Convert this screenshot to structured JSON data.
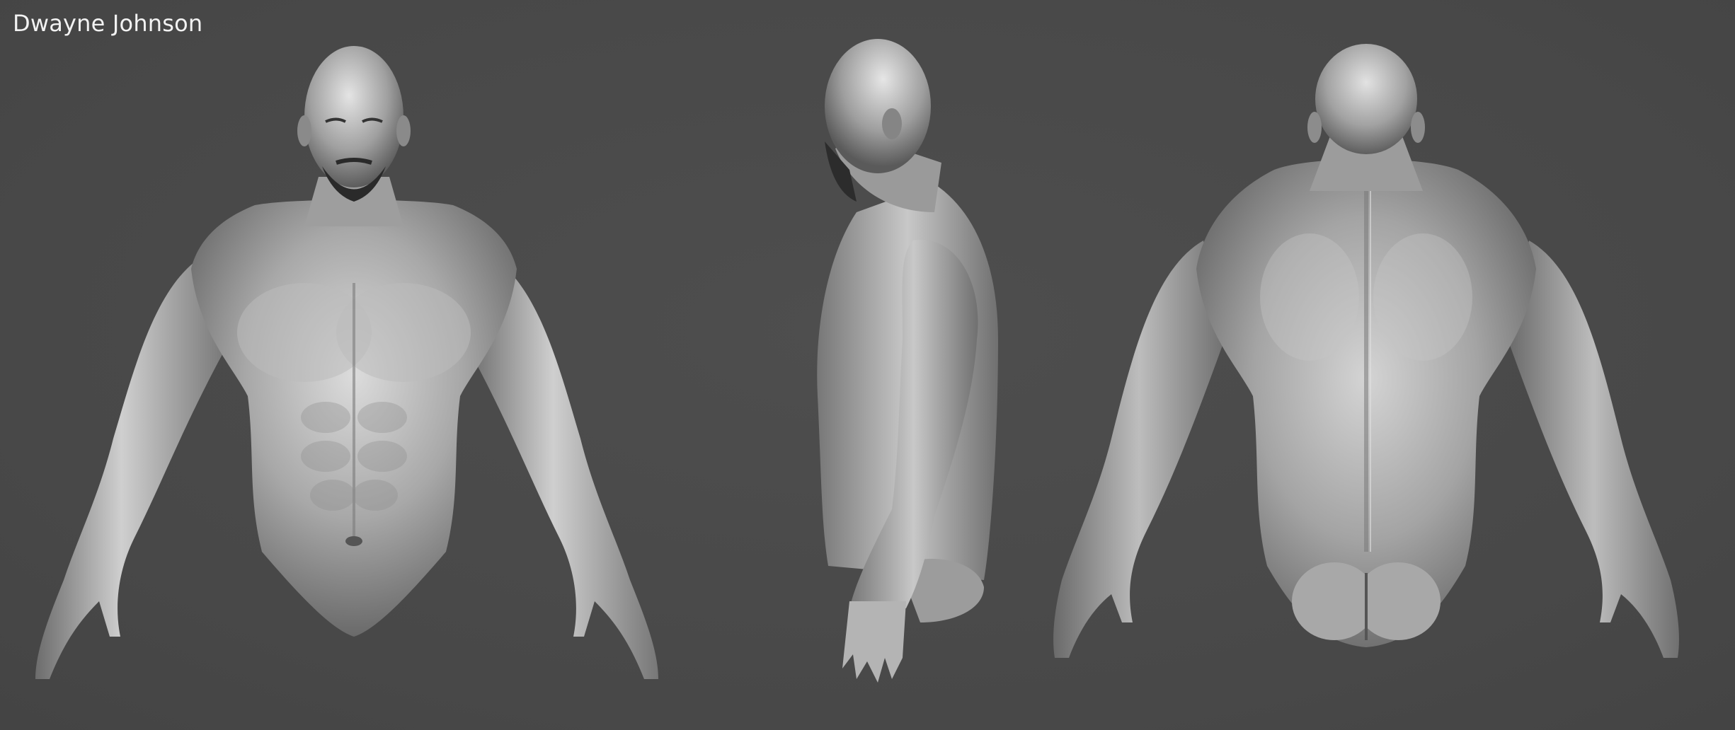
{
  "title": "Dwayne Johnson",
  "views": [
    {
      "name": "front"
    },
    {
      "name": "side"
    },
    {
      "name": "back"
    }
  ],
  "colors": {
    "background": "#4a4a4a",
    "skin_light": "#d9d9d9",
    "skin_mid": "#9a9a9a",
    "skin_dark": "#5e5e5e",
    "beard": "#2a2a2a",
    "title_text": "#f2f2f2"
  }
}
